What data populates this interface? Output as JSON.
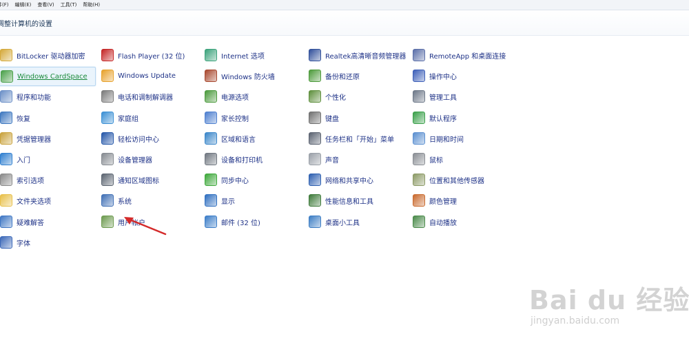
{
  "menu": [
    "件(F)",
    "编辑(E)",
    "查看(V)",
    "工具(T)",
    "帮助(H)"
  ],
  "title": "调整计算机的设置",
  "columns": [
    [
      {
        "label": "BitLocker 驱动器加密",
        "icon": "bitlocker-key-icon",
        "color": "#d4a93a"
      },
      {
        "label": "Windows CardSpace",
        "icon": "cardspace-icon",
        "color": "#4aa04a",
        "selected": true
      },
      {
        "label": "程序和功能",
        "icon": "programs-icon",
        "color": "#6b8fc7"
      },
      {
        "label": "恢复",
        "icon": "recovery-icon",
        "color": "#3e78c0"
      },
      {
        "label": "凭据管理器",
        "icon": "credential-icon",
        "color": "#c9a23c"
      },
      {
        "label": "入门",
        "icon": "getting-started-icon",
        "color": "#2f7fd0"
      },
      {
        "label": "索引选项",
        "icon": "indexing-icon",
        "color": "#8a8a8a"
      },
      {
        "label": "文件夹选项",
        "icon": "folder-options-icon",
        "color": "#e8c04a"
      },
      {
        "label": "疑难解答",
        "icon": "troubleshoot-icon",
        "color": "#3f77c4"
      },
      {
        "label": "字体",
        "icon": "fonts-icon",
        "color": "#3b68b8"
      }
    ],
    [
      {
        "label": "Flash Player (32 位)",
        "icon": "flash-icon",
        "color": "#c42323"
      },
      {
        "label": "Windows Update",
        "icon": "windows-update-icon",
        "color": "#e7a12a"
      },
      {
        "label": "电话和调制解调器",
        "icon": "phone-modem-icon",
        "color": "#7a7a7a"
      },
      {
        "label": "家庭组",
        "icon": "homegroup-icon",
        "color": "#3a8fd4"
      },
      {
        "label": "轻松访问中心",
        "icon": "ease-of-access-icon",
        "color": "#2456a8"
      },
      {
        "label": "设备管理器",
        "icon": "device-manager-icon",
        "color": "#858a90"
      },
      {
        "label": "通知区域图标",
        "icon": "notification-area-icon",
        "color": "#5b6470"
      },
      {
        "label": "系统",
        "icon": "system-icon",
        "color": "#3f6fb5"
      },
      {
        "label": "用户帐户",
        "icon": "user-accounts-icon",
        "color": "#6c9a4e"
      }
    ],
    [
      {
        "label": "Internet 选项",
        "icon": "internet-options-icon",
        "color": "#3aa27a"
      },
      {
        "label": "Windows 防火墙",
        "icon": "firewall-icon",
        "color": "#a8482e"
      },
      {
        "label": "电源选项",
        "icon": "power-options-icon",
        "color": "#4b9a3c"
      },
      {
        "label": "家长控制",
        "icon": "parental-controls-icon",
        "color": "#4d7fcf"
      },
      {
        "label": "区域和语言",
        "icon": "region-language-icon",
        "color": "#3a86c9"
      },
      {
        "label": "设备和打印机",
        "icon": "devices-printers-icon",
        "color": "#707780"
      },
      {
        "label": "同步中心",
        "icon": "sync-center-icon",
        "color": "#3da83a"
      },
      {
        "label": "显示",
        "icon": "display-icon",
        "color": "#2f6fc0"
      },
      {
        "label": "邮件 (32 位)",
        "icon": "mail-icon",
        "color": "#3b7dc8"
      }
    ],
    [
      {
        "label": "Realtek高清晰音频管理器",
        "icon": "realtek-audio-icon",
        "color": "#2f4f9a"
      },
      {
        "label": "备份和还原",
        "icon": "backup-restore-icon",
        "color": "#4c9a3a"
      },
      {
        "label": "个性化",
        "icon": "personalization-icon",
        "color": "#5e8f3c"
      },
      {
        "label": "键盘",
        "icon": "keyboard-icon",
        "color": "#707070"
      },
      {
        "label": "任务栏和「开始」菜单",
        "icon": "taskbar-start-icon",
        "color": "#5a6270"
      },
      {
        "label": "声音",
        "icon": "sound-icon",
        "color": "#9aa0a8"
      },
      {
        "label": "网络和共享中心",
        "icon": "network-sharing-icon",
        "color": "#2d5fb0"
      },
      {
        "label": "性能信息和工具",
        "icon": "performance-icon",
        "color": "#3e7a3a"
      },
      {
        "label": "桌面小工具",
        "icon": "desktop-gadgets-icon",
        "color": "#3c7dc4"
      }
    ],
    [
      {
        "label": "RemoteApp 和桌面连接",
        "icon": "remoteapp-icon",
        "color": "#5a6ea8"
      },
      {
        "label": "操作中心",
        "icon": "action-center-icon",
        "color": "#3d5fb8"
      },
      {
        "label": "管理工具",
        "icon": "admin-tools-icon",
        "color": "#6d7888"
      },
      {
        "label": "默认程序",
        "icon": "default-programs-icon",
        "color": "#3aa04a"
      },
      {
        "label": "日期和时间",
        "icon": "date-time-icon",
        "color": "#5b8fd0"
      },
      {
        "label": "鼠标",
        "icon": "mouse-icon",
        "color": "#8a8e94"
      },
      {
        "label": "位置和其他传感器",
        "icon": "location-sensors-icon",
        "color": "#8c9a66"
      },
      {
        "label": "颜色管理",
        "icon": "color-management-icon",
        "color": "#c96a2e"
      },
      {
        "label": "自动播放",
        "icon": "autoplay-icon",
        "color": "#4a8a4a"
      }
    ]
  ],
  "annotation_color": "#d42a2a",
  "watermark": {
    "logo": "Bai du 经验",
    "url": "jingyan.baidu.com"
  }
}
